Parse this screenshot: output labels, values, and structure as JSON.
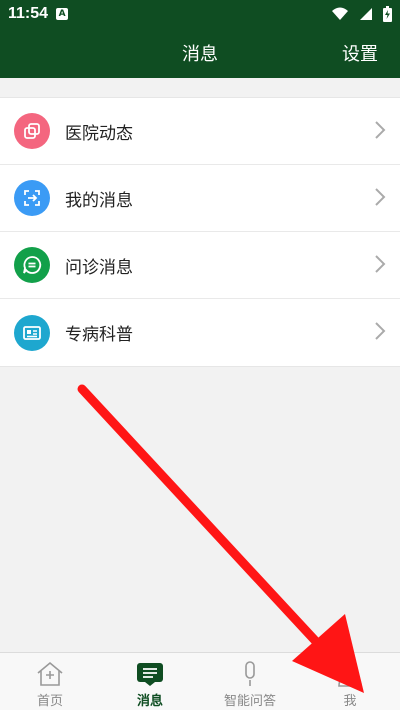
{
  "status_bar": {
    "time": "11:54",
    "notification_icon": "a-icon"
  },
  "header": {
    "title": "消息",
    "settings_label": "设置"
  },
  "menu": {
    "items": [
      {
        "label": "医院动态",
        "icon": "copy-squares-icon",
        "color": "#f4667f"
      },
      {
        "label": "我的消息",
        "icon": "scan-arrow-icon",
        "color": "#3b9bf5"
      },
      {
        "label": "问诊消息",
        "icon": "chat-bubble-icon",
        "color": "#12a04a"
      },
      {
        "label": "专病科普",
        "icon": "news-card-icon",
        "color": "#1ea7cf"
      }
    ]
  },
  "bottom_nav": {
    "items": [
      {
        "label": "首页",
        "icon": "home-icon"
      },
      {
        "label": "消息",
        "icon": "message-icon",
        "active": true
      },
      {
        "label": "智能问答",
        "icon": "microphone-icon"
      },
      {
        "label": "我",
        "icon": "person-icon"
      }
    ]
  },
  "colors": {
    "theme": "#0f4d22",
    "annotation_arrow": "#ff1515"
  }
}
